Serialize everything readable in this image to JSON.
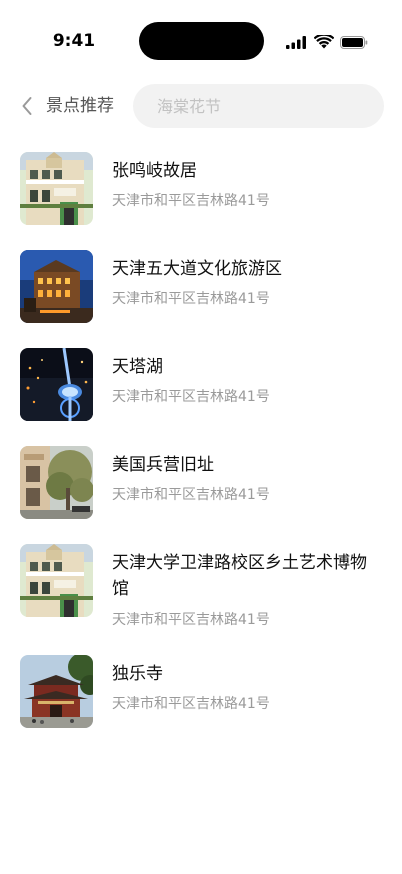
{
  "status_bar": {
    "time": "9:41"
  },
  "header": {
    "title": "景点推荐",
    "search_placeholder": "海棠花节",
    "search_value": ""
  },
  "list": [
    {
      "name": "张鸣岐故居",
      "address": "天津市和平区吉林路41号",
      "image": "colonial-building"
    },
    {
      "name": "天津五大道文化旅游区",
      "address": "天津市和平区吉林路41号",
      "image": "night-building"
    },
    {
      "name": "天塔湖",
      "address": "天津市和平区吉林路41号",
      "image": "tv-tower-night"
    },
    {
      "name": "美国兵营旧址",
      "address": "天津市和平区吉林路41号",
      "image": "old-barracks"
    },
    {
      "name": "天津大学卫津路校区乡土艺术博物馆",
      "address": "天津市和平区吉林路41号",
      "image": "colonial-building"
    },
    {
      "name": "独乐寺",
      "address": "天津市和平区吉林路41号",
      "image": "temple"
    }
  ]
}
